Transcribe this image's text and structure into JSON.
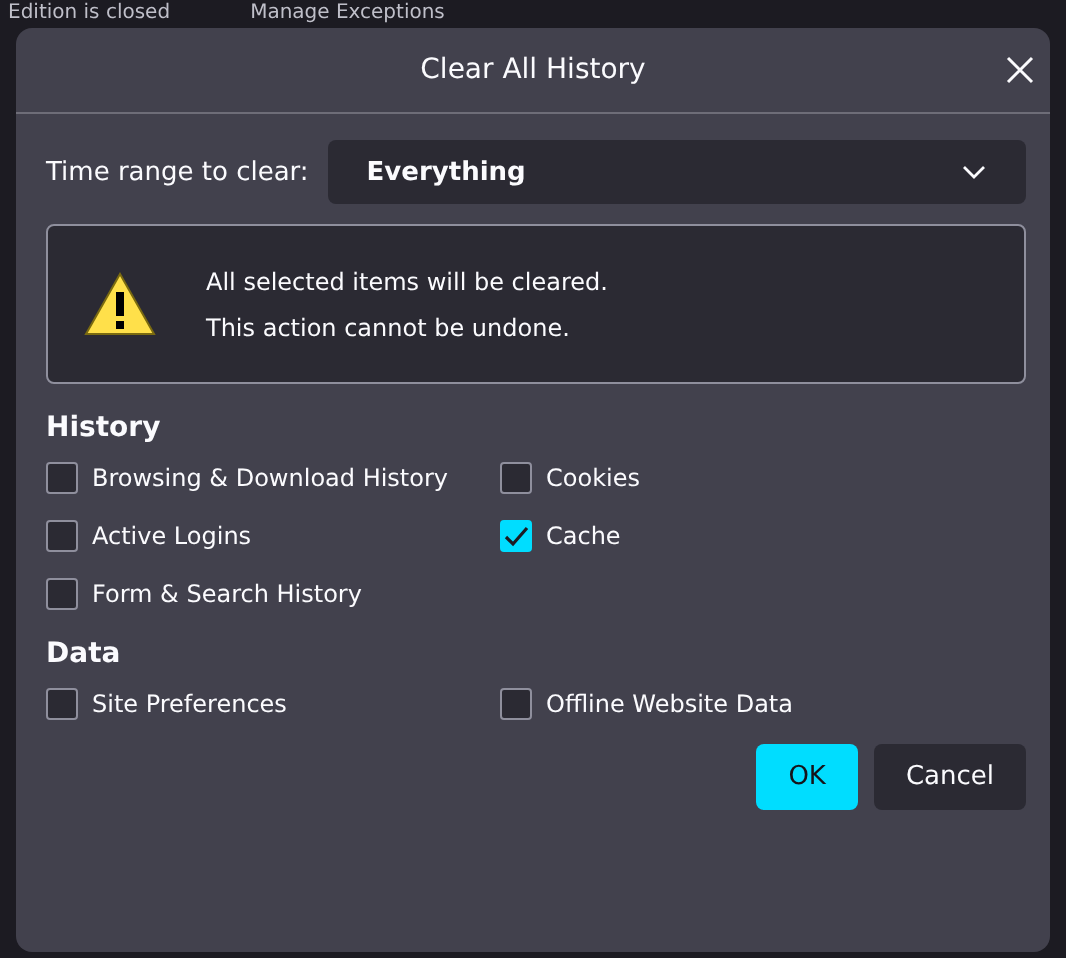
{
  "background": {
    "texts": [
      "Edition is closed",
      "Manage Exceptions"
    ]
  },
  "dialog": {
    "title": "Clear All History",
    "time_range": {
      "label": "Time range to clear:",
      "value": "Everything"
    },
    "warning": {
      "lines": [
        "All selected items will be cleared.",
        "This action cannot be undone."
      ]
    },
    "sections": [
      {
        "heading": "History",
        "items": [
          {
            "label": "Browsing & Download History",
            "checked": false
          },
          {
            "label": "Cookies",
            "checked": false
          },
          {
            "label": "Active Logins",
            "checked": false
          },
          {
            "label": "Cache",
            "checked": true
          },
          {
            "label": "Form & Search History",
            "checked": false
          }
        ]
      },
      {
        "heading": "Data",
        "items": [
          {
            "label": "Site Preferences",
            "checked": false
          },
          {
            "label": "Offline Website Data",
            "checked": false
          }
        ]
      }
    ],
    "buttons": [
      {
        "label": "OK",
        "kind": "primary"
      },
      {
        "label": "Cancel",
        "kind": "secondary"
      }
    ]
  }
}
